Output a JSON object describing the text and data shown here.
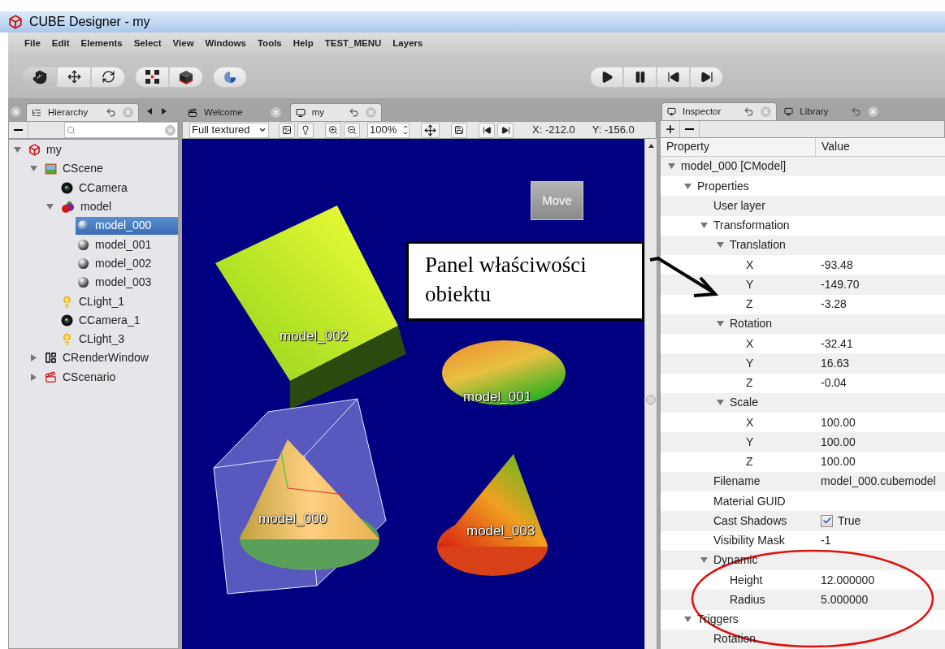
{
  "window": {
    "title": "CUBE Designer - my"
  },
  "menu": [
    "File",
    "Edit",
    "Elements",
    "Select",
    "View",
    "Windows",
    "Tools",
    "Help",
    "TEST_MENU",
    "Layers"
  ],
  "toolbar": {
    "groups": [
      [
        {
          "kind": "hand",
          "selected": true
        },
        {
          "kind": "move",
          "selected": false
        },
        {
          "kind": "rotate",
          "selected": false
        }
      ],
      [
        {
          "kind": "grid",
          "selected": false
        },
        {
          "kind": "cube",
          "selected": false
        }
      ],
      [
        {
          "kind": "pie",
          "selected": false
        }
      ]
    ],
    "playback": [
      {
        "kind": "play"
      },
      {
        "kind": "pause"
      },
      {
        "kind": "prev"
      },
      {
        "kind": "next"
      }
    ]
  },
  "hierarchy": {
    "tabs": [
      {
        "label": "Hierarchy",
        "selected": true
      }
    ],
    "tree": [
      {
        "label": "my",
        "kind": "root",
        "selected": false,
        "expanded": true,
        "children": [
          {
            "label": "CScene",
            "kind": "scene",
            "selected": false,
            "expanded": true,
            "children": [
              {
                "label": "CCamera",
                "kind": "camera",
                "selected": false
              },
              {
                "label": "model",
                "kind": "group",
                "selected": false,
                "expanded": true,
                "children": [
                  {
                    "label": "model_000",
                    "kind": "mesh",
                    "selected": true
                  },
                  {
                    "label": "model_001",
                    "kind": "mesh",
                    "selected": false
                  },
                  {
                    "label": "model_002",
                    "kind": "mesh",
                    "selected": false
                  },
                  {
                    "label": "model_003",
                    "kind": "mesh",
                    "selected": false
                  }
                ]
              },
              {
                "label": "CLight_1",
                "kind": "light",
                "selected": false
              },
              {
                "label": "CCamera_1",
                "kind": "camera",
                "selected": false
              },
              {
                "label": "CLight_3",
                "kind": "light",
                "selected": false
              }
            ]
          },
          {
            "label": "CRenderWindow",
            "kind": "window",
            "selected": false,
            "expanded": false
          },
          {
            "label": "CScenario",
            "kind": "scenario",
            "selected": false,
            "expanded": false
          }
        ]
      }
    ]
  },
  "viewport": {
    "tabs": [
      {
        "label": "Welcome",
        "selected": false,
        "kind": "welcome"
      },
      {
        "label": "my",
        "selected": true,
        "kind": "scene"
      }
    ],
    "render_mode": "Full textured",
    "zoom": "100%",
    "coord_x": "X: -212.0",
    "coord_y": "Y: -156.0",
    "button": "Move",
    "labels": [
      "model_002",
      "model_001",
      "model_000",
      "model_003"
    ],
    "annotation": "Panel właściwości obiektu"
  },
  "inspector": {
    "tabs": [
      {
        "label": "Inspector",
        "selected": true
      },
      {
        "label": "Library",
        "selected": false
      }
    ],
    "columns": [
      "Property",
      "Value"
    ],
    "rows": [
      {
        "name": "model_000 [CModel]",
        "kind": "group",
        "expanded": true,
        "children": [
          {
            "name": "Properties",
            "kind": "group",
            "expanded": true,
            "children": [
              {
                "name": "User layer",
                "kind": "text"
              },
              {
                "name": "Transformation",
                "kind": "group",
                "expanded": true,
                "children": [
                  {
                    "name": "Translation",
                    "kind": "group",
                    "expanded": true,
                    "children": [
                      {
                        "name": "X",
                        "kind": "text",
                        "value": "-93.48"
                      },
                      {
                        "name": "Y",
                        "kind": "text",
                        "value": "-149.70"
                      },
                      {
                        "name": "Z",
                        "kind": "text",
                        "value": "-3.28"
                      }
                    ]
                  },
                  {
                    "name": "Rotation",
                    "kind": "group",
                    "expanded": true,
                    "children": [
                      {
                        "name": "X",
                        "kind": "text",
                        "value": "-32.41"
                      },
                      {
                        "name": "Y",
                        "kind": "text",
                        "value": "16.63"
                      },
                      {
                        "name": "Z",
                        "kind": "text",
                        "value": "-0.04"
                      }
                    ]
                  },
                  {
                    "name": "Scale",
                    "kind": "group",
                    "expanded": true,
                    "children": [
                      {
                        "name": "X",
                        "kind": "text",
                        "value": "100.00"
                      },
                      {
                        "name": "Y",
                        "kind": "text",
                        "value": "100.00"
                      },
                      {
                        "name": "Z",
                        "kind": "text",
                        "value": "100.00"
                      }
                    ]
                  }
                ]
              },
              {
                "name": "Filename",
                "kind": "text",
                "value": "model_000.cubemodel"
              },
              {
                "name": "Material GUID",
                "kind": "text"
              },
              {
                "name": "Cast Shadows",
                "kind": "checkbox",
                "checked": true,
                "value": "True"
              },
              {
                "name": "Visibility Mask",
                "kind": "text",
                "value": "-1"
              },
              {
                "name": "Dynamic",
                "kind": "group",
                "expanded": true,
                "children": [
                  {
                    "name": "Height",
                    "kind": "text",
                    "value": "12.000000"
                  },
                  {
                    "name": "Radius",
                    "kind": "text",
                    "value": "5.000000"
                  }
                ]
              }
            ]
          },
          {
            "name": "Triggers",
            "kind": "group",
            "expanded": true,
            "children": [
              {
                "name": "Rotation",
                "kind": "text"
              }
            ]
          }
        ]
      }
    ]
  }
}
